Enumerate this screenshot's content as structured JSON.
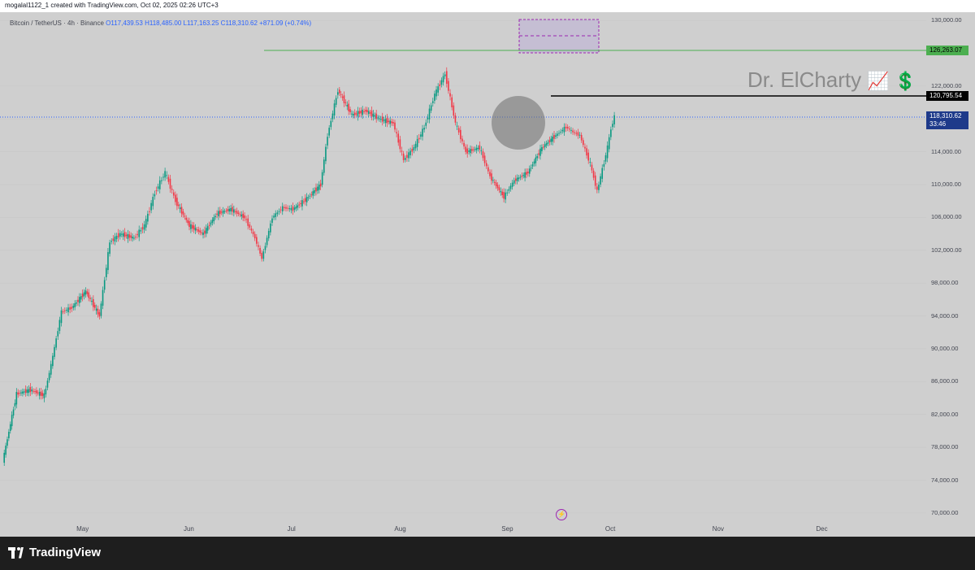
{
  "header": {
    "caption": "mogalal1122_1 created with TradingView.com, Oct 02, 2025 02:26 UTC+3"
  },
  "symbol": {
    "name": "Bitcoin / TetherUS · 4h · Binance",
    "open": "O117,439.53",
    "high": "H118,485.00",
    "low": "L117,163.25",
    "close": "C118,310.62",
    "change": "+871.09 (+0.74%)"
  },
  "watermark": {
    "text": "Dr. ElCharty",
    "emoji": "📈 💲"
  },
  "price_tags": {
    "green": "126,263.07",
    "black": "120,795.54",
    "current": "118,310.62",
    "countdown": "33:46"
  },
  "colors": {
    "background": "#cfcfcf",
    "up": "#089981",
    "down": "#f23645",
    "green_line": "#4caf50",
    "current_tag": "#1e3a8a",
    "zone": "#b39ddb"
  },
  "footer": {
    "brand": "TradingView"
  },
  "chart_data": {
    "type": "line",
    "title": "Bitcoin / TetherUS · 4h · Binance",
    "y_ticks": [
      "130,000.00",
      "122,000.00",
      "118,000.00",
      "114,000.00",
      "110,000.00",
      "106,000.00",
      "102,000.00",
      "98,000.00",
      "94,000.00",
      "90,000.00",
      "86,000.00",
      "82,000.00",
      "78,000.00",
      "74,000.00",
      "70,000.00"
    ],
    "x_ticks": [
      "May",
      "Jun",
      "Jul",
      "Aug",
      "Sep",
      "Oct",
      "Nov",
      "Dec"
    ],
    "ylim": [
      69000,
      131000
    ],
    "xlim": [
      "2025-04-07",
      "2025-12-31"
    ],
    "x": [
      "2025-04-08",
      "2025-04-12",
      "2025-04-16",
      "2025-04-20",
      "2025-04-22",
      "2025-04-25",
      "2025-04-28",
      "2025-05-02",
      "2025-05-06",
      "2025-05-09",
      "2025-05-12",
      "2025-05-16",
      "2025-05-19",
      "2025-05-22",
      "2025-05-25",
      "2025-05-28",
      "2025-06-01",
      "2025-06-05",
      "2025-06-09",
      "2025-06-13",
      "2025-06-17",
      "2025-06-20",
      "2025-06-22",
      "2025-06-25",
      "2025-06-28",
      "2025-07-01",
      "2025-07-05",
      "2025-07-09",
      "2025-07-11",
      "2025-07-14",
      "2025-07-18",
      "2025-07-22",
      "2025-07-26",
      "2025-07-30",
      "2025-08-02",
      "2025-08-05",
      "2025-08-08",
      "2025-08-11",
      "2025-08-14",
      "2025-08-17",
      "2025-08-20",
      "2025-08-24",
      "2025-08-27",
      "2025-08-31",
      "2025-09-03",
      "2025-09-07",
      "2025-09-11",
      "2025-09-15",
      "2025-09-18",
      "2025-09-20",
      "2025-09-22",
      "2025-09-25",
      "2025-09-27",
      "2025-09-30",
      "2025-10-01",
      "2025-10-02"
    ],
    "series": [
      {
        "values": [
          76300,
          84500,
          85000,
          84300,
          88000,
          94500,
          95000,
          97000,
          94000,
          103000,
          104000,
          103500,
          105000,
          109000,
          111500,
          108000,
          105000,
          104000,
          106500,
          107000,
          106000,
          103500,
          101000,
          106000,
          107200,
          107000,
          108300,
          110000,
          116000,
          121500,
          118500,
          119000,
          118000,
          117500,
          113000,
          114500,
          117000,
          121000,
          123500,
          117500,
          114000,
          114500,
          111000,
          108500,
          110500,
          111500,
          114500,
          116000,
          117000,
          116400,
          116000,
          112500,
          109200,
          114500,
          116800,
          118300
        ]
      }
    ]
  }
}
